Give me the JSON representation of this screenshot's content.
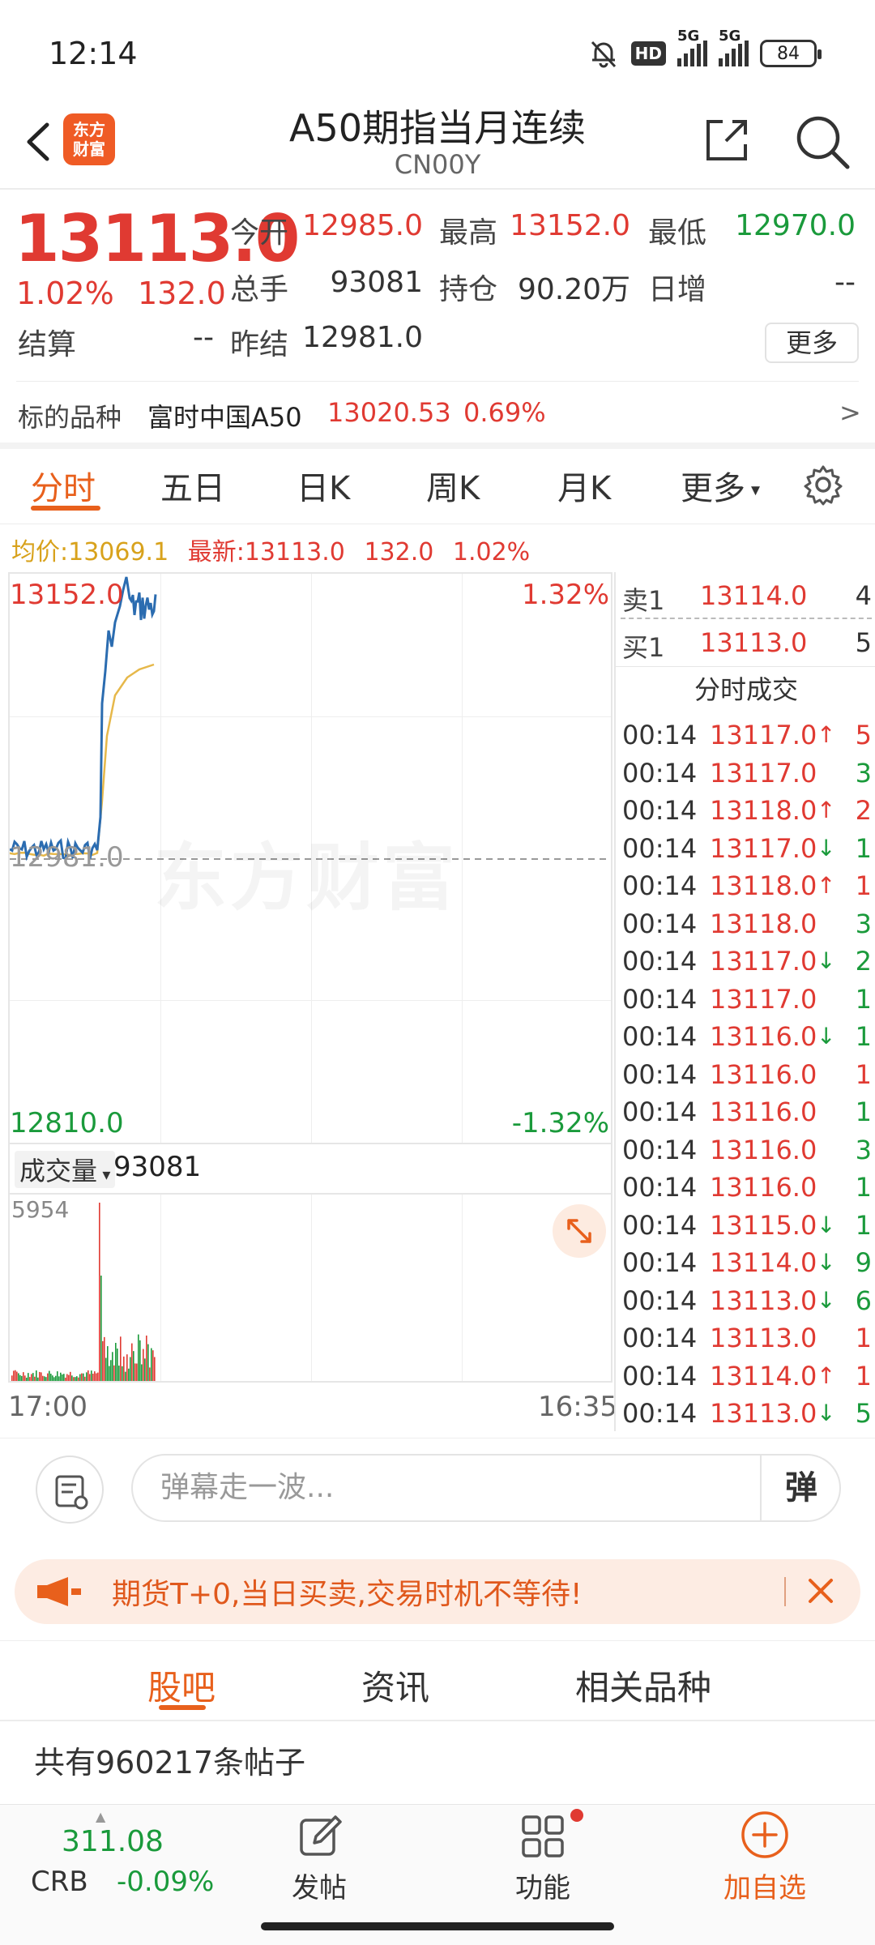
{
  "status_bar": {
    "time": "12:14",
    "battery": "84",
    "network": "5G",
    "hd": "HD"
  },
  "header": {
    "title": "A50期指当月连续",
    "subtitle": "CN00Y",
    "logo_text": "东方财富"
  },
  "quote": {
    "price": "13113.0",
    "change_pct": "1.02%",
    "change_abs": "132.0",
    "open_label": "今开",
    "open": "12985.0",
    "high_label": "最高",
    "high": "13152.0",
    "low_label": "最低",
    "low": "12970.0",
    "volume_label": "总手",
    "volume": "93081",
    "oi_label": "持仓",
    "oi": "90.20万",
    "daily_inc_label": "日增",
    "daily_inc": "--",
    "settle_label": "结算",
    "settle": "--",
    "prev_settle_label": "昨结",
    "prev_settle": "12981.0",
    "more_label": "更多"
  },
  "underlying": {
    "label": "标的品种",
    "name": "富时中国A50",
    "price": "13020.53",
    "pct": "0.69%",
    "arrow": ">"
  },
  "chart_tabs": [
    "分时",
    "五日",
    "日K",
    "周K",
    "月K",
    "更多"
  ],
  "summary": {
    "avg_label": "均价:",
    "avg": "13069.1",
    "latest_label": "最新:",
    "latest": "13113.0",
    "chg": "132.0",
    "pct": "1.02%"
  },
  "chart_labels": {
    "top_price": "13152.0",
    "top_pct": "1.32%",
    "bottom_price": "12810.0",
    "bottom_pct": "-1.32%",
    "mid_price": "12981.0",
    "watermark": "东方财富"
  },
  "volume": {
    "label": "成交量",
    "value": "93081",
    "max": "5954",
    "start_time": "17:00",
    "end_time": "16:35"
  },
  "order_book": {
    "ask": {
      "label": "卖1",
      "price": "13114.0",
      "qty": "4"
    },
    "bid": {
      "label": "买1",
      "price": "13113.0",
      "qty": "5"
    },
    "trades_title": "分时成交",
    "trades": [
      {
        "time": "00:14",
        "price": "13117.0",
        "dir": "↑",
        "qty": "5",
        "qty_color": "red"
      },
      {
        "time": "00:14",
        "price": "13117.0",
        "dir": "",
        "qty": "3",
        "qty_color": "green"
      },
      {
        "time": "00:14",
        "price": "13118.0",
        "dir": "↑",
        "qty": "2",
        "qty_color": "red"
      },
      {
        "time": "00:14",
        "price": "13117.0",
        "dir": "↓",
        "qty": "1",
        "qty_color": "green"
      },
      {
        "time": "00:14",
        "price": "13118.0",
        "dir": "↑",
        "qty": "1",
        "qty_color": "red"
      },
      {
        "time": "00:14",
        "price": "13118.0",
        "dir": "",
        "qty": "3",
        "qty_color": "green"
      },
      {
        "time": "00:14",
        "price": "13117.0",
        "dir": "↓",
        "qty": "2",
        "qty_color": "green"
      },
      {
        "time": "00:14",
        "price": "13117.0",
        "dir": "",
        "qty": "1",
        "qty_color": "green"
      },
      {
        "time": "00:14",
        "price": "13116.0",
        "dir": "↓",
        "qty": "1",
        "qty_color": "green"
      },
      {
        "time": "00:14",
        "price": "13116.0",
        "dir": "",
        "qty": "1",
        "qty_color": "red"
      },
      {
        "time": "00:14",
        "price": "13116.0",
        "dir": "",
        "qty": "1",
        "qty_color": "green"
      },
      {
        "time": "00:14",
        "price": "13116.0",
        "dir": "",
        "qty": "3",
        "qty_color": "green"
      },
      {
        "time": "00:14",
        "price": "13116.0",
        "dir": "",
        "qty": "1",
        "qty_color": "green"
      },
      {
        "time": "00:14",
        "price": "13115.0",
        "dir": "↓",
        "qty": "1",
        "qty_color": "green"
      },
      {
        "time": "00:14",
        "price": "13114.0",
        "dir": "↓",
        "qty": "9",
        "qty_color": "green"
      },
      {
        "time": "00:14",
        "price": "13113.0",
        "dir": "↓",
        "qty": "6",
        "qty_color": "green"
      },
      {
        "time": "00:14",
        "price": "13113.0",
        "dir": "",
        "qty": "1",
        "qty_color": "red"
      },
      {
        "time": "00:14",
        "price": "13114.0",
        "dir": "↑",
        "qty": "1",
        "qty_color": "red"
      },
      {
        "time": "00:14",
        "price": "13113.0",
        "dir": "↓",
        "qty": "5",
        "qty_color": "green"
      }
    ]
  },
  "danmaku": {
    "placeholder": "弹幕走一波...",
    "toggle": "弹"
  },
  "promo": {
    "text": "期货T+0,当日买卖,交易时机不等待!"
  },
  "section_tabs": [
    "股吧",
    "资讯",
    "相关品种"
  ],
  "post_count": "共有960217条帖子",
  "bottom_bar": {
    "crb_value": "311.08",
    "crb_label": "CRB",
    "crb_change": "-0.09%",
    "post": "发帖",
    "function": "功能",
    "add_watch": "加自选"
  },
  "colors": {
    "up": "#e03a32",
    "down": "#1a9a3b",
    "accent": "#e8601c",
    "price_line": "#2b6cb0",
    "avg_line": "#e6b84a"
  }
}
